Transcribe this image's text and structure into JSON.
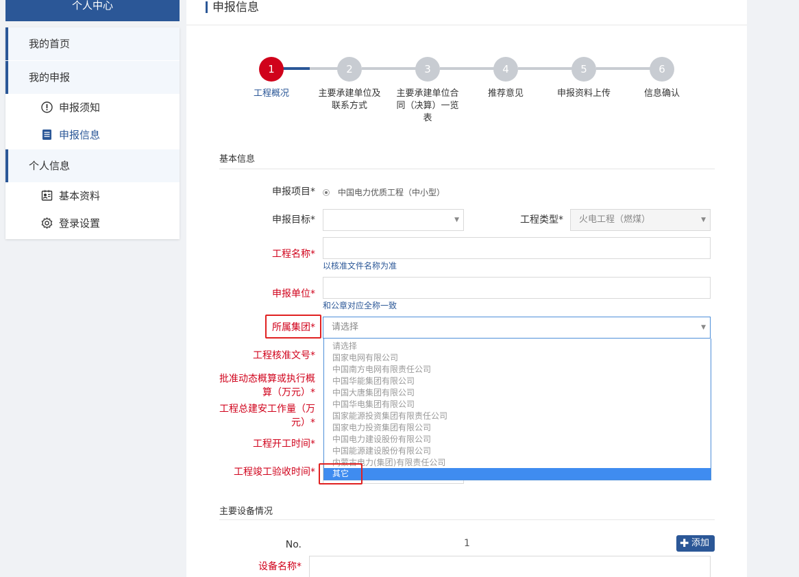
{
  "sidebar": {
    "header": "个人中心",
    "items": [
      {
        "label": "我的首页"
      },
      {
        "label": "我的申报"
      },
      {
        "label": "申报须知"
      },
      {
        "label": "申报信息"
      },
      {
        "label": "个人信息"
      },
      {
        "label": "基本资料"
      },
      {
        "label": "登录设置"
      }
    ]
  },
  "page": {
    "title": "申报信息"
  },
  "steps": [
    {
      "num": "1",
      "label": "工程概况"
    },
    {
      "num": "2",
      "label": "主要承建单位及联系方式"
    },
    {
      "num": "3",
      "label": "主要承建单位合同（决算）一览表"
    },
    {
      "num": "4",
      "label": "推荐意见"
    },
    {
      "num": "5",
      "label": "申报资料上传"
    },
    {
      "num": "6",
      "label": "信息确认"
    }
  ],
  "current_step": 1,
  "basic_info": {
    "section_title": "基本信息",
    "project_label": "申报项目*",
    "project_option": "中国电力优质工程（中小型）",
    "target_label": "申报目标*",
    "target_value": "",
    "type_label": "工程类型*",
    "type_value": "火电工程（燃煤）",
    "name_label": "工程名称*",
    "name_hint": "以核准文件名称为准",
    "unit_label": "申报单位*",
    "unit_hint": "和公章对应全称一致",
    "group_label": "所属集团*",
    "group_value": "请选择",
    "approval_label": "工程核准文号*",
    "budget_label_1": "批准动态概算或执行概",
    "budget_label_2": "算（万元）*",
    "workload_label_1": "工程总建安工作量（万",
    "workload_label_2": "元）*",
    "start_label": "工程开工时间*",
    "finish_label": "工程竣工验收时间*"
  },
  "group_options": [
    "请选择",
    "国家电网有限公司",
    "中国南方电网有限责任公司",
    "中国华能集团有限公司",
    "中国大唐集团有限公司",
    "中国华电集团有限公司",
    "国家能源投资集团有限责任公司",
    "国家电力投资集团有限公司",
    "中国电力建设股份有限公司",
    "中国能源建设股份有限公司",
    "内蒙古电力(集团)有限责任公司",
    "其它"
  ],
  "group_highlighted": "其它",
  "equipment": {
    "section_title": "主要设备情况",
    "no_label": "No.",
    "no_value": "1",
    "add_label": "添加",
    "name_label": "设备名称*"
  },
  "colors": {
    "primary": "#2b5797",
    "active_step": "#d0021b",
    "highlight": "#e02020",
    "selected_option": "#3f8cf0"
  }
}
